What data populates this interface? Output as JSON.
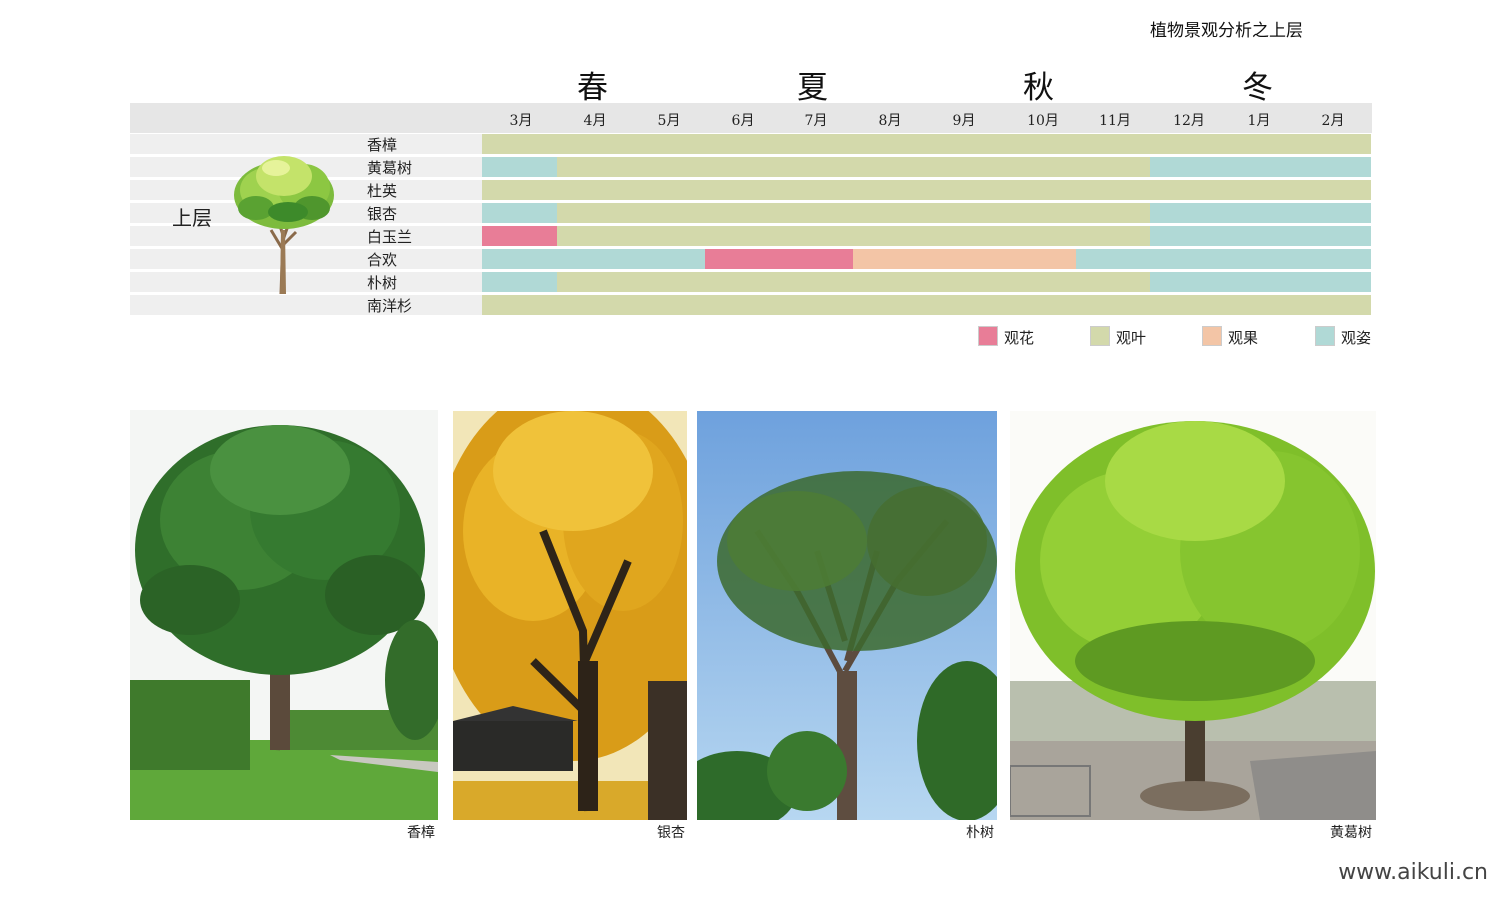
{
  "page_title": "植物景观分析之上层",
  "watermark": "www.aikuli.cn",
  "legend": {
    "flower": {
      "label": "观花",
      "color": "#e87d97"
    },
    "leaf": {
      "label": "观叶",
      "color": "#d3d9ab"
    },
    "fruit": {
      "label": "观果",
      "color": "#f3c5a6"
    },
    "form": {
      "label": "观姿",
      "color": "#b0d9d6"
    }
  },
  "chart_data": {
    "type": "table",
    "layer_label": "上层",
    "seasons": [
      "春",
      "夏",
      "秋",
      "冬"
    ],
    "months": [
      "3月",
      "4月",
      "5月",
      "6月",
      "7月",
      "8月",
      "9月",
      "10月",
      "11月",
      "12月",
      "1月",
      "2月"
    ],
    "rows": [
      {
        "name": "香樟",
        "segments": [
          {
            "from": "3月",
            "to": "2月",
            "type": "观叶"
          }
        ]
      },
      {
        "name": "黄葛树",
        "segments": [
          {
            "from": "3月",
            "to": "3月",
            "type": "观姿"
          },
          {
            "from": "4月",
            "to": "11月",
            "type": "观叶"
          },
          {
            "from": "12月",
            "to": "2月",
            "type": "观姿"
          }
        ]
      },
      {
        "name": "杜英",
        "segments": [
          {
            "from": "3月",
            "to": "2月",
            "type": "观叶"
          }
        ]
      },
      {
        "name": "银杏",
        "segments": [
          {
            "from": "3月",
            "to": "3月",
            "type": "观姿"
          },
          {
            "from": "4月",
            "to": "11月",
            "type": "观叶"
          },
          {
            "from": "12月",
            "to": "2月",
            "type": "观姿"
          }
        ]
      },
      {
        "name": "白玉兰",
        "segments": [
          {
            "from": "3月",
            "to": "3月",
            "type": "观花"
          },
          {
            "from": "4月",
            "to": "11月",
            "type": "观叶"
          },
          {
            "from": "12月",
            "to": "2月",
            "type": "观姿"
          }
        ]
      },
      {
        "name": "合欢",
        "segments": [
          {
            "from": "3月",
            "to": "5月",
            "type": "观姿"
          },
          {
            "from": "6月",
            "to": "7月",
            "type": "观花"
          },
          {
            "from": "8月",
            "to": "10月",
            "type": "观果"
          },
          {
            "from": "11月",
            "to": "2月",
            "type": "观姿"
          }
        ]
      },
      {
        "name": "朴树",
        "segments": [
          {
            "from": "3月",
            "to": "3月",
            "type": "观姿"
          },
          {
            "from": "4月",
            "to": "11月",
            "type": "观叶"
          },
          {
            "from": "12月",
            "to": "2月",
            "type": "观姿"
          }
        ]
      },
      {
        "name": "南洋杉",
        "segments": [
          {
            "from": "3月",
            "to": "2月",
            "type": "观叶"
          }
        ]
      }
    ]
  },
  "photos": [
    {
      "caption": "香樟"
    },
    {
      "caption": "银杏"
    },
    {
      "caption": "朴树"
    },
    {
      "caption": "黄葛树"
    }
  ]
}
